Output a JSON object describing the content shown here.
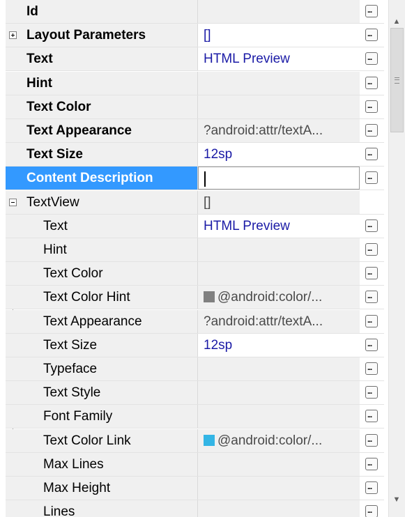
{
  "properties": {
    "top": [
      {
        "label": "Id",
        "value": "",
        "state": "empty"
      },
      {
        "label": "Layout Parameters",
        "value": "[]",
        "state": "set",
        "expander": "plus"
      },
      {
        "label": "Text",
        "value": "HTML Preview",
        "state": "set"
      },
      {
        "label": "Hint",
        "value": "",
        "state": "empty"
      },
      {
        "label": "Text Color",
        "value": "",
        "state": "empty"
      },
      {
        "label": "Text Appearance",
        "value": "?android:attr/textA...",
        "state": "default"
      },
      {
        "label": "Text Size",
        "value": "12sp",
        "state": "set"
      },
      {
        "label": "Content Description",
        "value": "",
        "state": "editing",
        "selected": true
      }
    ],
    "group": {
      "label": "TextView",
      "value": "[]",
      "expander": "minus"
    },
    "children": [
      {
        "label": "Text",
        "value": "HTML Preview",
        "state": "set"
      },
      {
        "label": "Hint",
        "value": "",
        "state": "empty"
      },
      {
        "label": "Text Color",
        "value": "",
        "state": "empty"
      },
      {
        "label": "Text Color Hint",
        "value": "@android:color/...",
        "state": "default",
        "swatch": "#808080"
      },
      {
        "label": "Text Appearance",
        "value": "?android:attr/textA...",
        "state": "default"
      },
      {
        "label": "Text Size",
        "value": "12sp",
        "state": "set"
      },
      {
        "label": "Typeface",
        "value": "",
        "state": "empty"
      },
      {
        "label": "Text Style",
        "value": "",
        "state": "empty"
      },
      {
        "label": "Font Family",
        "value": "",
        "state": "empty"
      },
      {
        "label": "Text Color Link",
        "value": "@android:color/...",
        "state": "default",
        "swatch": "#33b5e5"
      },
      {
        "label": "Max Lines",
        "value": "",
        "state": "empty"
      },
      {
        "label": "Max Height",
        "value": "",
        "state": "empty"
      },
      {
        "label": "Lines",
        "value": "",
        "state": "empty"
      }
    ]
  },
  "ellipsis_label": "...",
  "scrollbar": {
    "up_icon": "arrow-up-icon",
    "down_icon": "arrow-down-icon"
  }
}
